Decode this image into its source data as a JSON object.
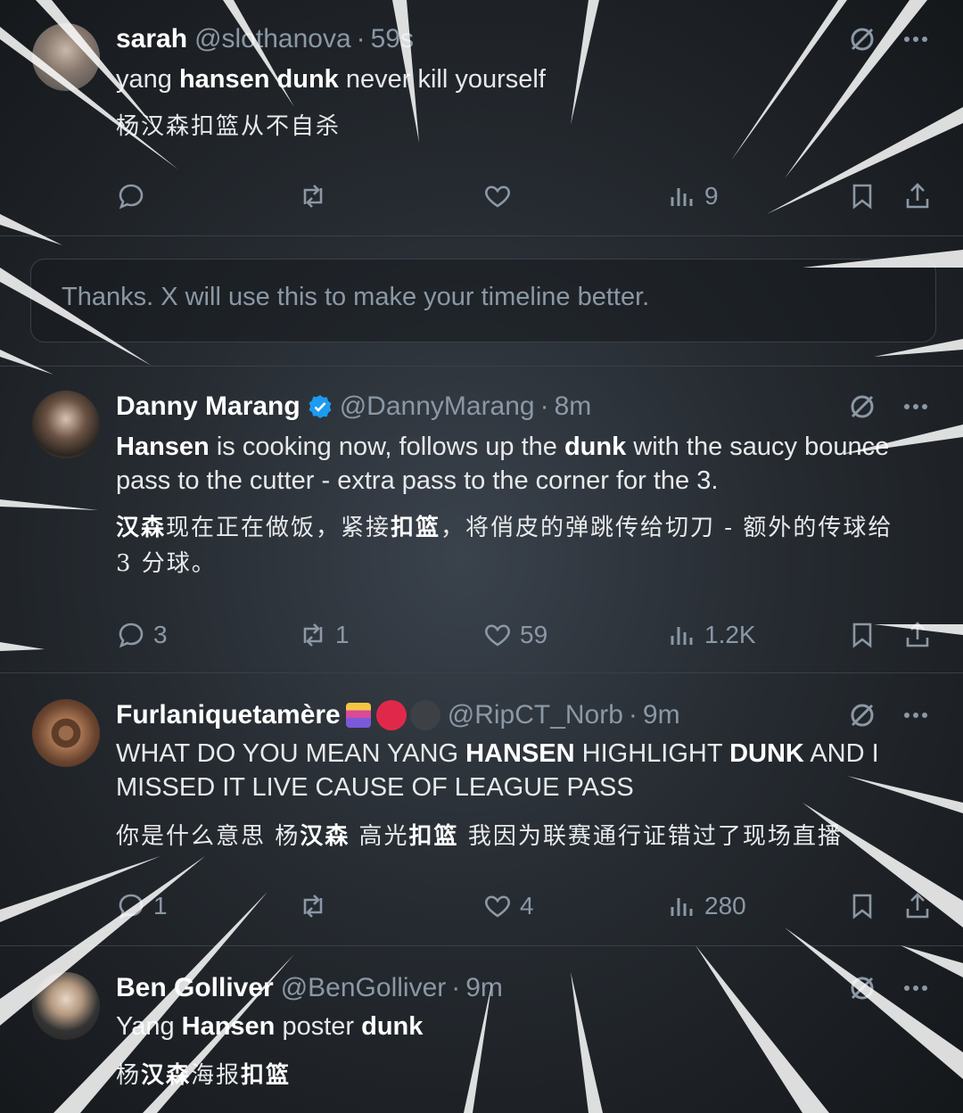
{
  "tweets": [
    {
      "name": "sarah",
      "handle": "@slothanova",
      "sep": "·",
      "time": "59s",
      "text_parts": [
        "yang ",
        "hansen dunk",
        " never kill yourself"
      ],
      "zh": "杨汉森扣篮从不自杀",
      "actions": {
        "replies": "",
        "reposts": "",
        "likes": "",
        "views": "9"
      }
    },
    {
      "name": "Danny Marang",
      "handle": "@DannyMarang",
      "sep": "·",
      "time": "8m",
      "text_parts": [
        "Hansen",
        " is cooking now, follows up the ",
        "dunk",
        " with the saucy bounce pass to the cutter - extra pass to the corner for the 3."
      ],
      "zh_parts": [
        "汉森",
        "现在正在做饭，紧接",
        "扣篮",
        "，将俏皮的弹跳传给切刀 - 额外的传球给 3 分球。"
      ],
      "actions": {
        "replies": "3",
        "reposts": "1",
        "likes": "59",
        "views": "1.2K"
      }
    },
    {
      "name": "Furlaniquetamère",
      "handle": "@RipCT_Norb",
      "sep": "·",
      "time": "9m",
      "text_parts": [
        "WHAT DO YOU MEAN YANG ",
        "HANSEN",
        " HIGHLIGHT ",
        "DUNK",
        " AND I MISSED IT LIVE CAUSE OF LEAGUE PASS"
      ],
      "zh_parts": [
        "你是什么意思 杨",
        "汉森",
        " 高光",
        "扣篮",
        " 我因为联赛通行证错过了现场直播"
      ],
      "actions": {
        "replies": "1",
        "reposts": "",
        "likes": "4",
        "views": "280"
      }
    },
    {
      "name": "Ben Golliver",
      "handle": "@BenGolliver",
      "sep": "·",
      "time": "9m",
      "text_parts": [
        "Yang ",
        "Hansen",
        " poster ",
        "dunk"
      ],
      "zh_parts": [
        "杨",
        "汉森",
        "海报",
        "扣篮"
      ]
    }
  ],
  "feedback": {
    "message": "Thanks. X will use this to make your timeline better."
  },
  "colors": {
    "background": "#15181c",
    "text": "#e7e9ea",
    "muted": "#8b98a5",
    "verified": "#1d9bf0",
    "divider": "#3a4048"
  }
}
